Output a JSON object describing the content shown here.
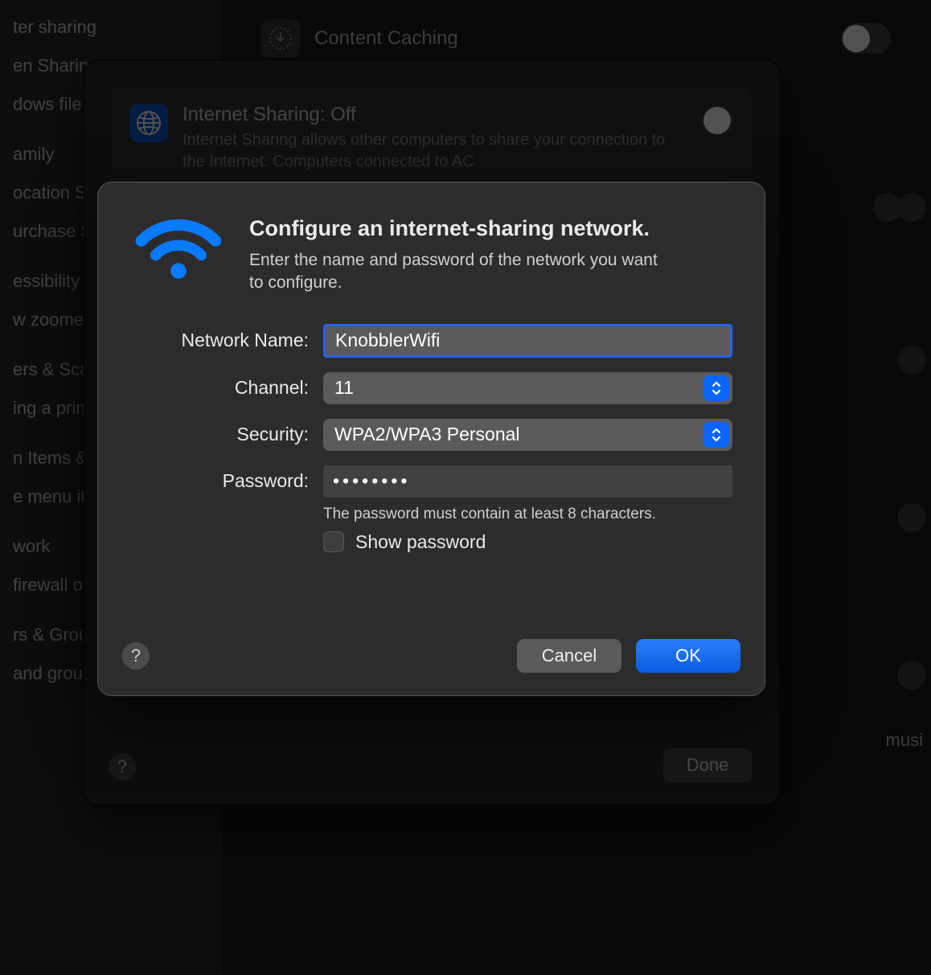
{
  "sidebar": {
    "items": [
      "ter sharing",
      "en Sharing",
      "dows file",
      "amily",
      "ocation S",
      "urchase S",
      "essibility",
      "w zoomed\ne screen s",
      "ers & Sca",
      "ing a prin",
      "n Items &",
      "e menu it",
      "work",
      " firewall o",
      "rs & Grou",
      " and grou"
    ]
  },
  "content": {
    "caching_label": "Content Caching",
    "right_label": "musi"
  },
  "outer": {
    "title": "Internet Sharing: Off",
    "desc": "Internet Sharing allows other computers to share your connection to the Internet. Computers connected to AC",
    "done": "Done"
  },
  "modal": {
    "title": "Configure an internet-sharing network.",
    "sub": "Enter the name and password of the network you want to configure.",
    "labels": {
      "network": "Network Name:",
      "channel": "Channel:",
      "security": "Security:",
      "password": "Password:"
    },
    "values": {
      "network": "KnobblerWifi",
      "channel": "11",
      "security": "WPA2/WPA3 Personal",
      "password": "••••••••"
    },
    "hint": "The password must contain at least 8 characters.",
    "show_password": "Show password",
    "cancel": "Cancel",
    "ok": "OK"
  }
}
